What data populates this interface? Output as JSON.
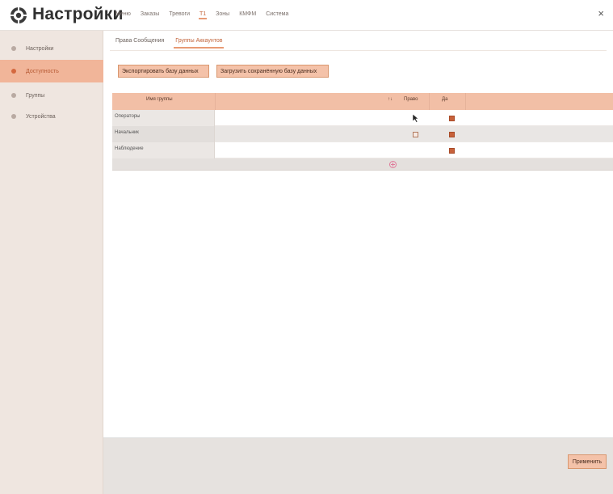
{
  "app": {
    "title": "Настройки",
    "close_glyph": "×",
    "icon": "settings-logo-icon"
  },
  "top_menu": [
    {
      "label": "Меню"
    },
    {
      "label": "Заказы"
    },
    {
      "label": "Тревоги"
    },
    {
      "label": "Т1",
      "active": true
    },
    {
      "label": "Зоны"
    },
    {
      "label": "КМФМ"
    },
    {
      "label": "Система"
    }
  ],
  "sidebar": {
    "items": [
      {
        "label": "Настройки",
        "icon": "dot-icon",
        "active": false
      },
      {
        "label": "Доступность",
        "icon": "dot-icon",
        "active": true
      },
      {
        "label": "Группы",
        "icon": "dot-icon",
        "active": false
      },
      {
        "label": "Устройства",
        "icon": "dot-icon",
        "active": false
      }
    ]
  },
  "main": {
    "tabs": [
      {
        "label": "Права Сообщения",
        "active": false
      },
      {
        "label": "Группы Аккаунтов",
        "active": true
      }
    ],
    "buttons": {
      "export": "Экспортировать базу данных",
      "import": "Загрузить сохранённую базу данных"
    },
    "table": {
      "headers": {
        "name": "Имя группы",
        "sort": "↑↓",
        "right": "Право",
        "yes": "Да"
      },
      "rows": [
        {
          "name": "Операторы",
          "right": "cursor",
          "yes": true
        },
        {
          "name": "Начальник",
          "right": "box",
          "yes": true
        },
        {
          "name": "Наблюдение",
          "right": "",
          "yes": true
        }
      ]
    }
  },
  "footer": {
    "apply_label": "Применить"
  },
  "colors": {
    "accent": "#f1b599",
    "accent_dark": "#c2643b",
    "sidebar_bg": "#efe6e0",
    "footer_bg": "#e6e2df"
  }
}
